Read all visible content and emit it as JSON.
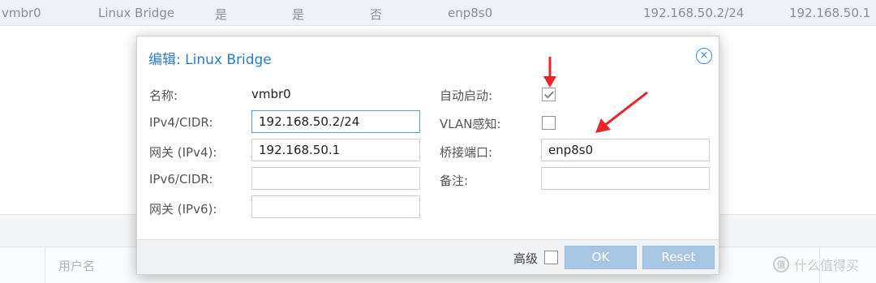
{
  "background": {
    "table_row": {
      "name": "vmbr0",
      "type": "Linux Bridge",
      "active": "是",
      "autostart": "是",
      "vlan_aware": "否",
      "ports": "enp8s0",
      "cidr": "192.168.50.2/24",
      "gateway": "192.168.50.1"
    },
    "user_column_header": "用户名",
    "watermark": "什么值得买",
    "watermark_logo": "值"
  },
  "dialog": {
    "title": "编辑: Linux Bridge",
    "close_icon": "×",
    "left": {
      "name_label": "名称:",
      "name_value": "vmbr0",
      "ipv4_label": "IPv4/CIDR:",
      "ipv4_value": "192.168.50.2/24",
      "gw4_label": "网关 (IPv4):",
      "gw4_value": "192.168.50.1",
      "ipv6_label": "IPv6/CIDR:",
      "ipv6_value": "",
      "gw6_label": "网关 (IPv6):",
      "gw6_value": ""
    },
    "right": {
      "autostart_label": "自动启动:",
      "autostart_checked": true,
      "vlan_label": "VLAN感知:",
      "vlan_checked": false,
      "ports_label": "桥接端口:",
      "ports_value": "enp8s0",
      "comment_label": "备注:",
      "comment_value": ""
    },
    "footer": {
      "advanced_label": "高级",
      "advanced_checked": false,
      "ok_label": "OK",
      "reset_label": "Reset"
    }
  },
  "colors": {
    "annotation_arrow": "#e8252b",
    "title_blue": "#2b7cc7",
    "disabled_button": "#a7c6e3"
  }
}
